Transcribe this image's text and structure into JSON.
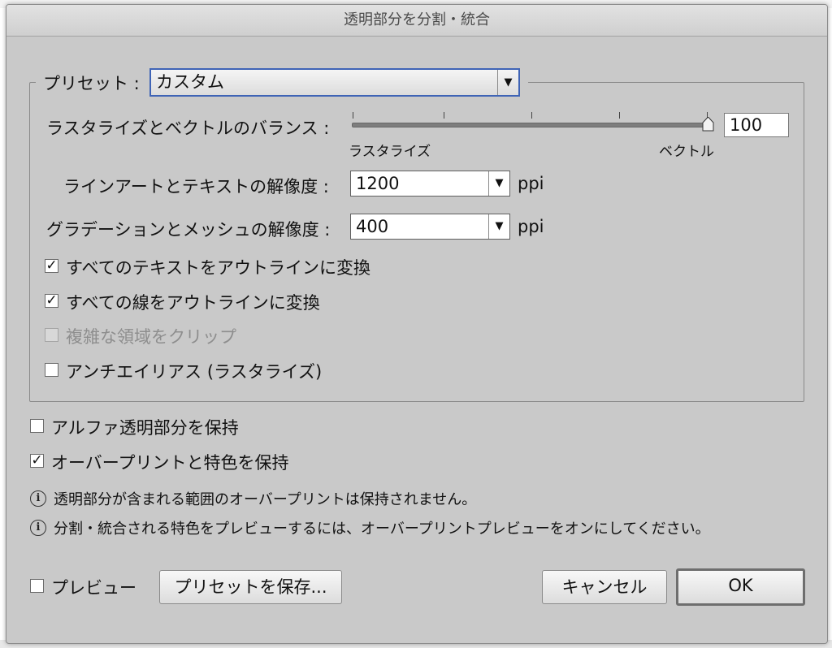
{
  "dialog": {
    "title": "透明部分を分割・統合"
  },
  "preset": {
    "label": "プリセット :",
    "value": "カスタム"
  },
  "balance": {
    "label": "ラスタライズとベクトルのバランス :",
    "value": "100",
    "left_label": "ラスタライズ",
    "right_label": "ベクトル",
    "level_percent": 100
  },
  "line_art_resolution": {
    "label": "ラインアートとテキストの解像度 :",
    "value": "1200",
    "unit": "ppi"
  },
  "gradient_resolution": {
    "label": "グラデーションとメッシュの解像度 :",
    "value": "400",
    "unit": "ppi"
  },
  "options": {
    "convert_text": {
      "label": "すべてのテキストをアウトラインに変換",
      "checked": true
    },
    "convert_strokes": {
      "label": "すべての線をアウトラインに変換",
      "checked": true
    },
    "clip_complex": {
      "label": "複雑な領域をクリップ",
      "checked": false,
      "disabled": true
    },
    "antialias": {
      "label": "アンチエイリアス (ラスタライズ)",
      "checked": false
    }
  },
  "preserve_alpha": {
    "label": "アルファ透明部分を保持",
    "checked": false
  },
  "preserve_overprint": {
    "label": "オーバープリントと特色を保持",
    "checked": true
  },
  "info": {
    "line1": "透明部分が含まれる範囲のオーバープリントは保持されません。",
    "line2": "分割・統合される特色をプレビューするには、オーバープリントプレビューをオンにしてください。"
  },
  "footer": {
    "preview_label": "プレビュー",
    "preview_checked": false,
    "save_preset": "プリセットを保存...",
    "cancel": "キャンセル",
    "ok": "OK"
  },
  "colors": {
    "dialog_bg": "#c9c9c9",
    "focus_ring": "#3f64b6"
  },
  "icons": {
    "checkmark": "checkmark-icon",
    "dropdown": "triangle-down-icon",
    "info": "info-icon",
    "slider_thumb": "slider-thumb-icon"
  }
}
